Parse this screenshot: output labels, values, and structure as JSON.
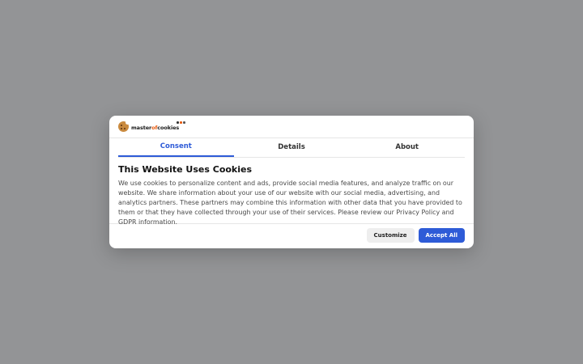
{
  "logo": {
    "text_prefix": "master",
    "text_accent": "of",
    "text_suffix": "cookies",
    "icon": "cookie-icon",
    "dot_colors": [
      "#333333",
      "#e8590c",
      "#555555"
    ]
  },
  "tabs": [
    {
      "label": "Consent",
      "active": true
    },
    {
      "label": "Details",
      "active": false
    },
    {
      "label": "About",
      "active": false
    }
  ],
  "content": {
    "title": "This Website Uses Cookies",
    "body": "We use cookies to personalize content and ads, provide social media features, and analyze traffic on our website. We share information about your use of our website with our social media, advertising, and analytics partners. These partners may combine this information with other data that you have provided to them or that they have collected through your use of their services. Please review our Privacy Policy and GDPR information."
  },
  "actions": {
    "customize_label": "Customize",
    "accept_label": "Accept All"
  },
  "colors": {
    "accent": "#2e5bd7",
    "overlay": "#939496",
    "brand_orange": "#e8590c"
  }
}
